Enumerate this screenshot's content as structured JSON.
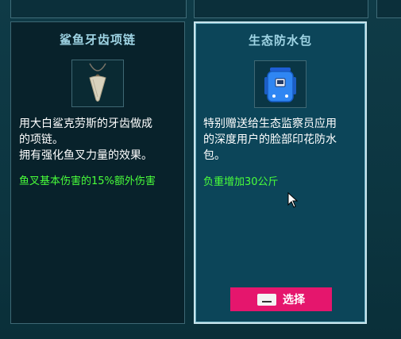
{
  "cards": [
    {
      "title": "鲨鱼牙齿项链",
      "icon": "shark-tooth-necklace-icon",
      "description_lines": [
        "用大白鲨克劳斯的牙齿做成",
        "的项链。",
        "拥有强化鱼叉力量的效果。"
      ],
      "effect": "鱼叉基本伤害的15%额外伤害",
      "selected": false
    },
    {
      "title": "生态防水包",
      "icon": "waterproof-backpack-icon",
      "description_lines": [
        "特别赠送给生态监察员应用",
        "的深度用户的脸部印花防水",
        "包。"
      ],
      "effect": "负重增加30公斤",
      "selected": true,
      "button_label": "选择",
      "button_key_icon": "spacebar-key-icon"
    }
  ],
  "colors": {
    "title": "#9fd4e4",
    "effect": "#49ff3a",
    "button": "#e5166d",
    "selected_card_bg": "#0c4559",
    "card_bg": "#08222b"
  }
}
